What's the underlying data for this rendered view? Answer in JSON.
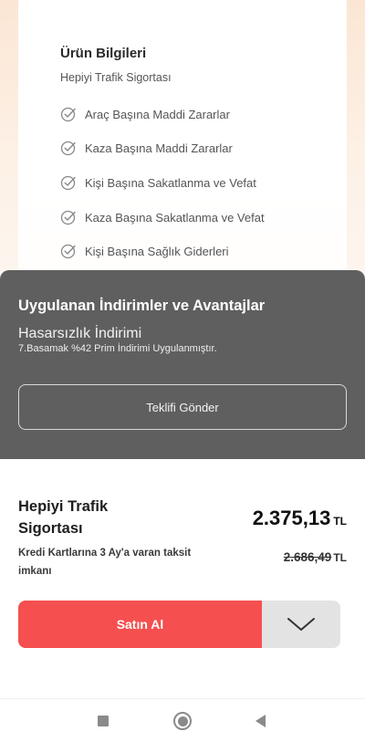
{
  "product_info": {
    "title": "Ürün Bilgileri",
    "subtitle": "Hepiyi Trafik Sigortası",
    "features": [
      {
        "label": "Araç Başına Maddi Zararlar",
        "icon": "check-circle-icon"
      },
      {
        "label": "Kaza Başına Maddi Zararlar",
        "icon": "check-circle-icon"
      },
      {
        "label": "Kişi Başına Sakatlanma ve Vefat",
        "icon": "check-circle-icon"
      },
      {
        "label": "Kaza Başına Sakatlanma ve Vefat",
        "icon": "check-circle-icon"
      },
      {
        "label": "Kişi Başına Sağlık Giderleri",
        "icon": "check-circle-icon"
      }
    ]
  },
  "discounts": {
    "title": "Uygulanan İndirimler ve Avantajlar",
    "item_name": "Hasarsızlık İndirimi",
    "item_desc": "7.Basamak %42 Prim İndirimi Uygulanmıştır.",
    "send_offer_label": "Teklifi Gönder"
  },
  "purchase": {
    "product_name": "Hepiyi Trafik Sigortası",
    "price": "2.375,13",
    "currency": "TL",
    "old_price": "2.686,49",
    "promo": "Kredi Kartlarına 3 Ay'a varan taksit imkanı",
    "buy_label": "Satın Al"
  },
  "colors": {
    "accent": "#f54f4f",
    "sheet": "#5f5f5f",
    "background": "#fdf1e6"
  }
}
